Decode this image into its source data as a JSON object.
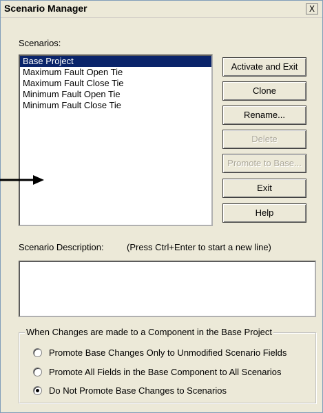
{
  "window": {
    "title": "Scenario Manager",
    "close_glyph": "X"
  },
  "scenarios": {
    "label": "Scenarios:",
    "items": [
      {
        "label": "Base Project",
        "selected": true
      },
      {
        "label": "Maximum Fault Open Tie",
        "selected": false
      },
      {
        "label": "Maximum Fault Close Tie",
        "selected": false
      },
      {
        "label": "Minimum Fault Open Tie",
        "selected": false
      },
      {
        "label": "Minimum Fault Close Tie",
        "selected": false
      }
    ]
  },
  "buttons": {
    "activate_exit": "Activate and Exit",
    "clone": "Clone",
    "rename": "Rename...",
    "delete": "Delete",
    "promote": "Promote to Base...",
    "exit": "Exit",
    "help": "Help"
  },
  "description": {
    "label": "Scenario Description:",
    "hint": "(Press Ctrl+Enter to start a new line)",
    "value": ""
  },
  "group": {
    "legend": "When Changes are made to a Component in the Base Project",
    "options": [
      {
        "label": "Promote Base Changes Only to Unmodified Scenario Fields",
        "checked": false
      },
      {
        "label": "Promote All Fields in the Base Component to All Scenarios",
        "checked": false
      },
      {
        "label": "Do Not Promote Base Changes to Scenarios",
        "checked": true
      }
    ]
  },
  "icons": {
    "arrow": "arrow-right-icon",
    "close": "close-icon"
  }
}
